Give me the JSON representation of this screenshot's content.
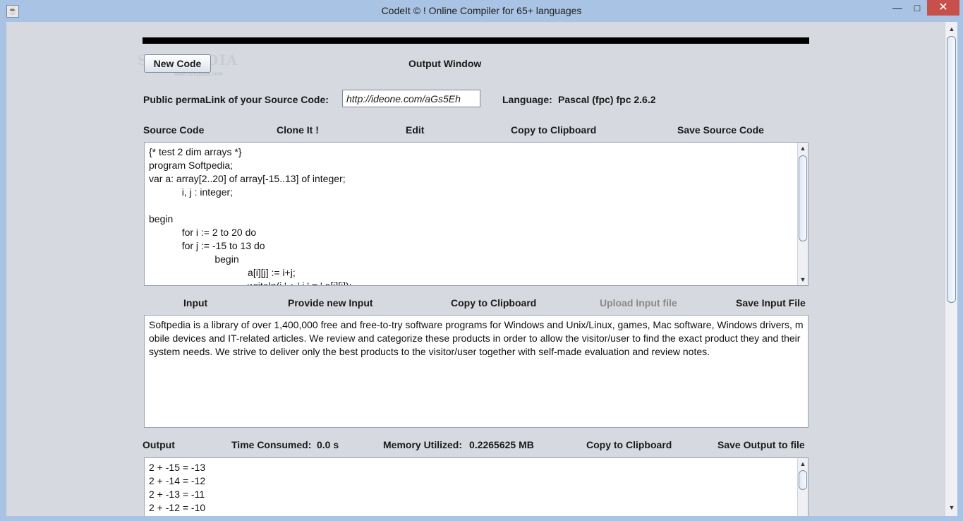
{
  "window": {
    "title": "CodeIt © ! Online Compiler for 65+ languages",
    "minimize_glyph": "—",
    "maximize_glyph": "□",
    "close_glyph": "✕",
    "app_icon": "java-cup-icon"
  },
  "watermark": {
    "text": "SOFTPEDIA",
    "sub": "www.softpedia.com"
  },
  "header": {
    "new_code": "New Code",
    "output_window": "Output Window",
    "permalink_label": "Public  permaLink of your Source Code:",
    "permalink_value": "http://ideone.com/aGs5Eh",
    "language_label": "Language:",
    "language_value": "Pascal (fpc) fpc 2.6.2"
  },
  "source": {
    "title": "Source Code",
    "clone": "Clone It !",
    "edit": "Edit",
    "copy": "Copy to Clipboard",
    "save": "Save Source Code",
    "code": "{* test 2 dim arrays *}\nprogram Softpedia;\nvar a: array[2..20] of array[-15..13] of integer;\n\t\ti, j : integer;\n\nbegin\n\t\tfor i := 2 to 20 do\n\t\tfor j := -15 to 13 do\n\t\t\t\tbegin\n\t\t\t\t\t\ta[i][j] := i+j;\n\t\t\t\t\t\twriteln(i,' + ',j,' = ',a[i][j]);"
  },
  "input": {
    "title": "Input",
    "provide_new": "Provide new Input",
    "copy": "Copy to Clipboard",
    "upload": "Upload Input file",
    "save": "Save Input File",
    "text": "Softpedia is a library of over 1,400,000 free and free-to-try software programs for Windows and Unix/Linux, games, Mac software, Windows drivers, mobile devices and IT-related articles. We review and categorize these products in order to allow the visitor/user to find the exact product they and their system needs. We strive to deliver only the best products to the visitor/user together with self-made evaluation and review notes."
  },
  "output": {
    "title": "Output",
    "time_label": "Time Consumed:",
    "time_value": "0.0 s",
    "memory_label": "Memory Utilized:",
    "memory_value": "0.2265625 MB",
    "copy": "Copy to Clipboard",
    "save": "Save Output to file",
    "text": "2 + -15 = -13\n2 + -14 = -12\n2 + -13 = -11\n2 + -12 = -10"
  }
}
